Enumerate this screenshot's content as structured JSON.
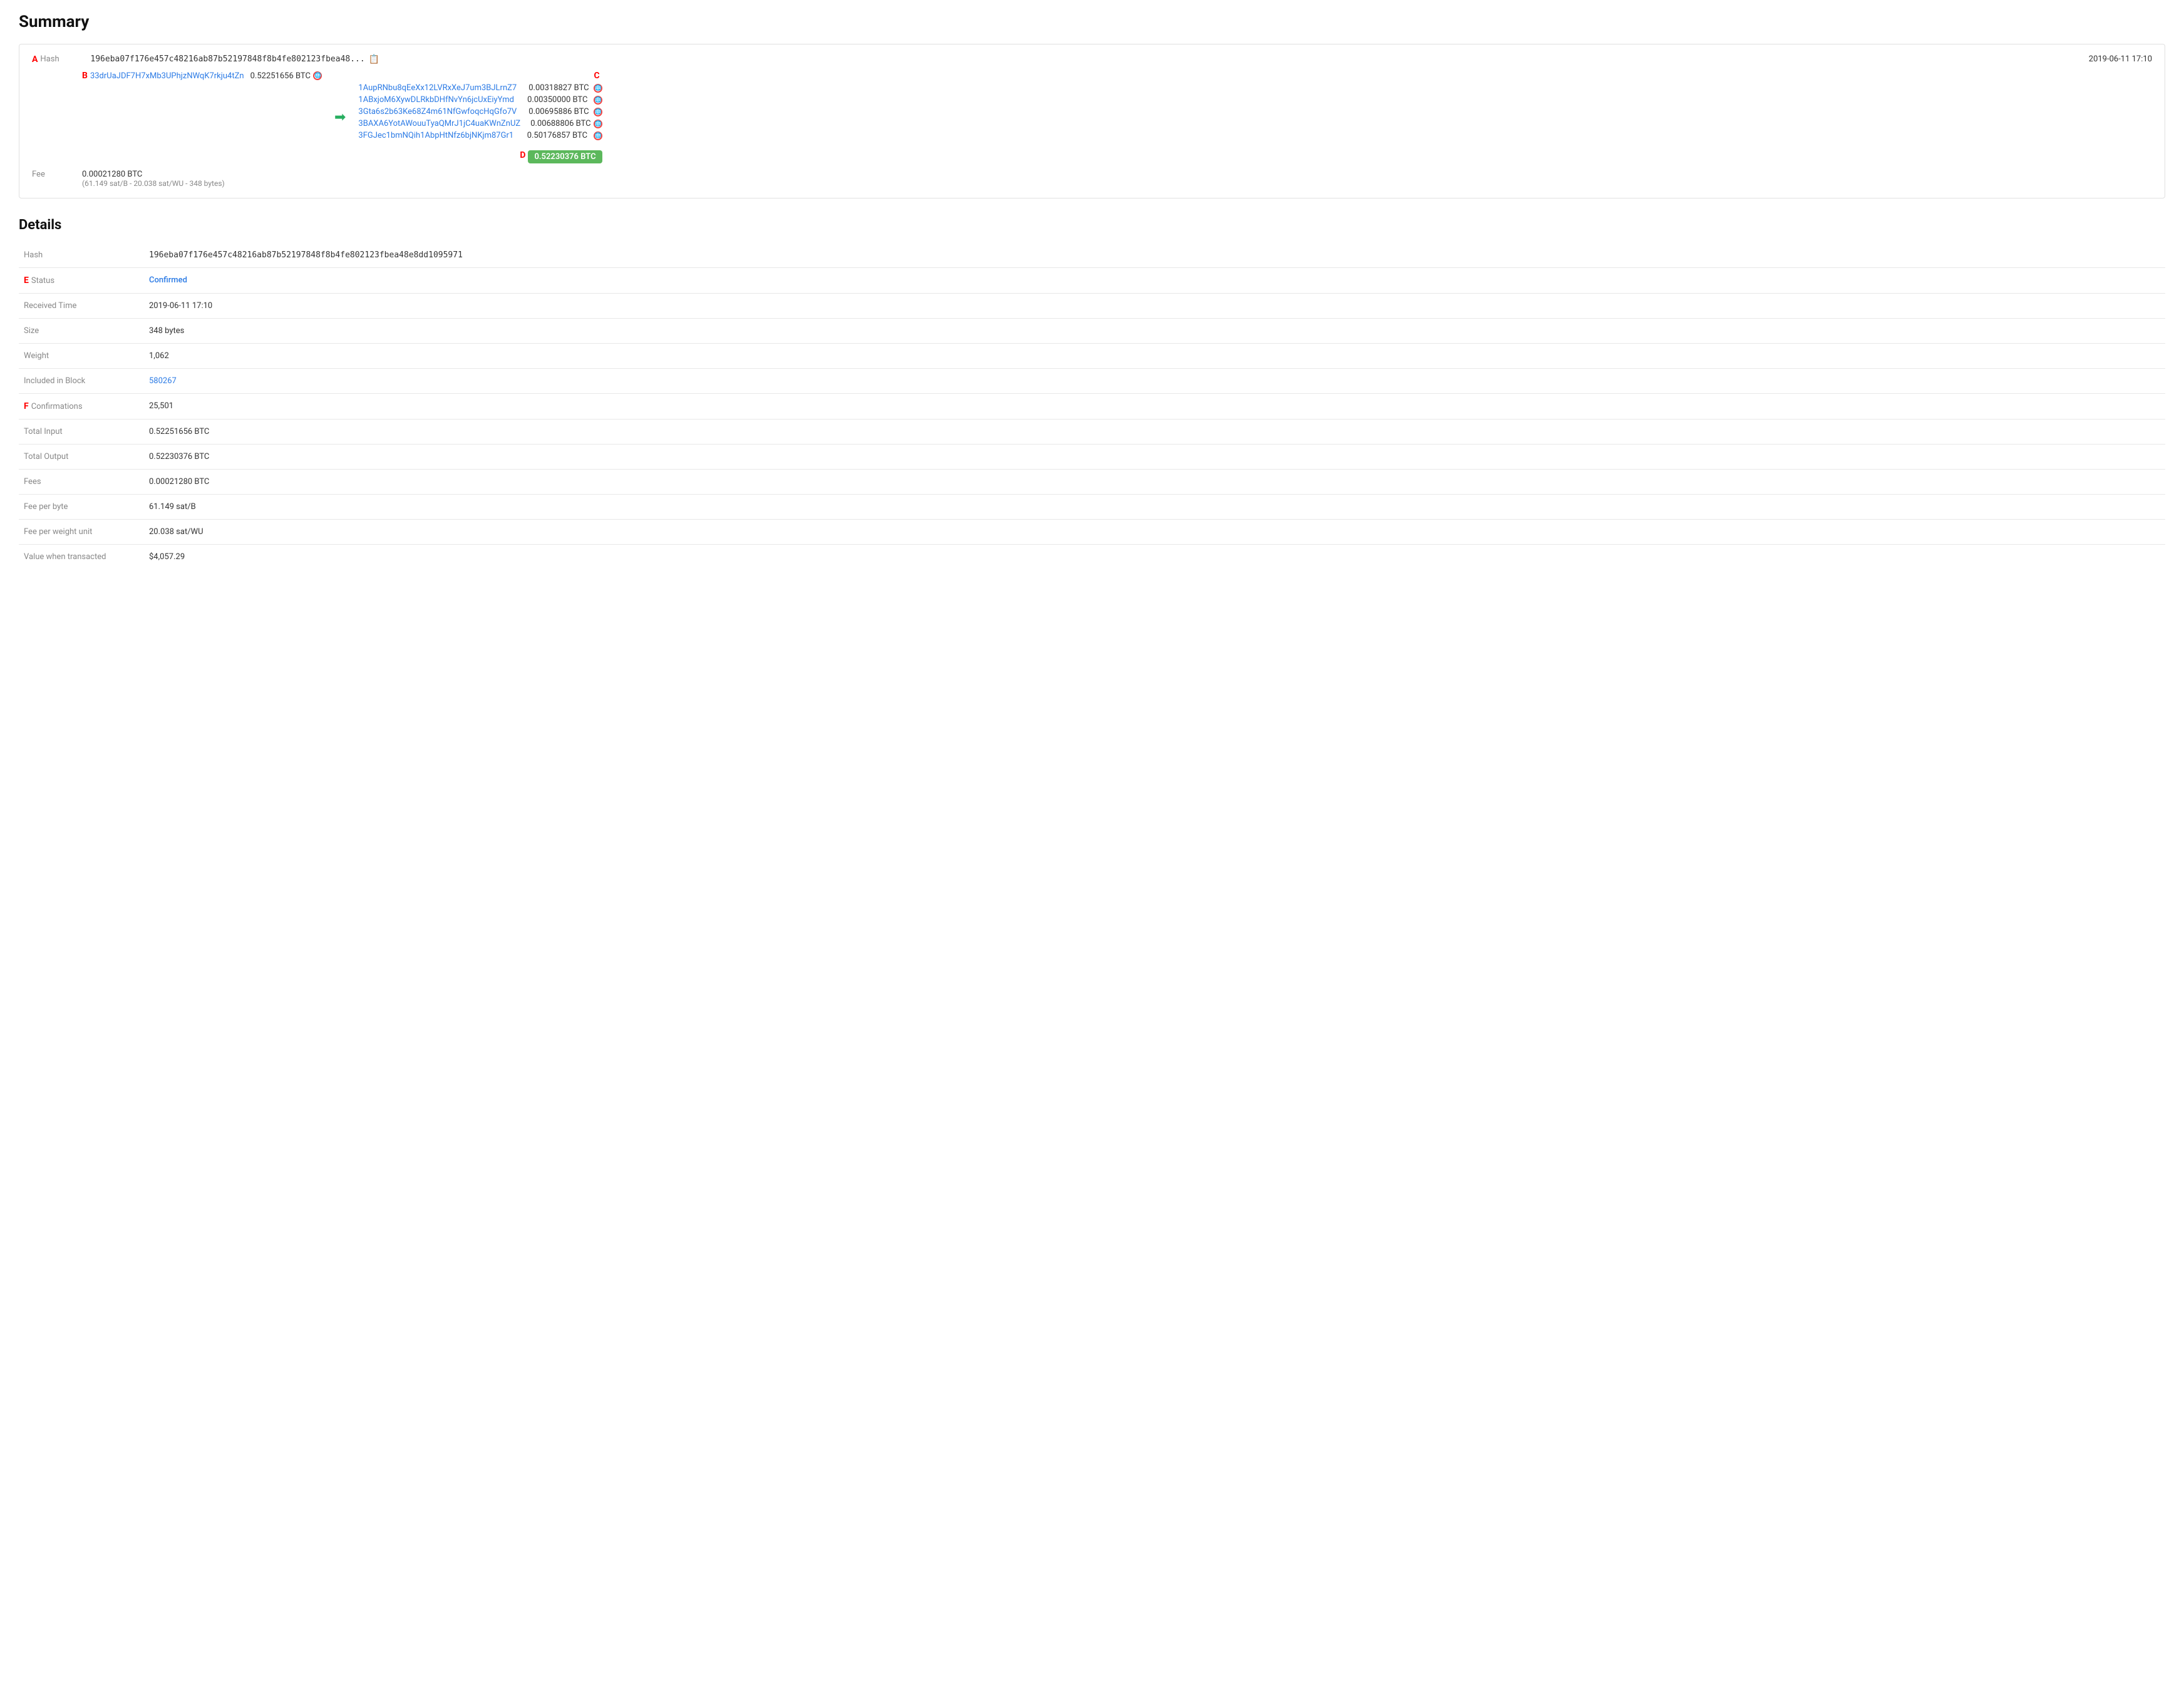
{
  "page": {
    "summary_title": "Summary",
    "details_title": "Details"
  },
  "summary": {
    "hash_label": "Hash",
    "hash_short": "196eba07f176e457c48216ab87b52197848f8b4fe802123fbea48...",
    "timestamp": "2019-06-11 17:10",
    "input_address": "33drUaJDF7H7xMb3UPhjzNWqK7rkju4tZn",
    "input_amount": "0.52251656 BTC",
    "outputs": [
      {
        "address": "1AupRNbu8qEeXx12LVRxXeJ7um3BJLrnZ7",
        "amount": "0.00318827 BTC"
      },
      {
        "address": "1ABxjoM6XywDLRkbDHfNvYn6jcUxEiyYmd",
        "amount": "0.00350000 BTC"
      },
      {
        "address": "3Gta6s2b63Ke68Z4m61NfGwfoqcHqGfo7V",
        "amount": "0.00695886 BTC"
      },
      {
        "address": "3BAXA6YotAWouuTyaQMrJ1jC4uaKWnZnUZ",
        "amount": "0.00688806 BTC"
      },
      {
        "address": "3FGJec1bmNQih1AbpHtNfz6bjNKjm87Gr1",
        "amount": "0.50176857 BTC"
      }
    ],
    "total_output": "0.52230376 BTC",
    "fee_label": "Fee",
    "fee_value": "0.00021280 BTC",
    "fee_detail": "(61.149 sat/B - 20.038 sat/WU - 348 bytes)"
  },
  "details": {
    "rows": [
      {
        "label": "Hash",
        "value": "196eba07f176e457c48216ab87b52197848f8b4fe802123fbea48e8dd1095971",
        "type": "hash"
      },
      {
        "label": "Status",
        "value": "Confirmed",
        "type": "status"
      },
      {
        "label": "Received Time",
        "value": "2019-06-11 17:10",
        "type": "text"
      },
      {
        "label": "Size",
        "value": "348 bytes",
        "type": "text"
      },
      {
        "label": "Weight",
        "value": "1,062",
        "type": "text"
      },
      {
        "label": "Included in Block",
        "value": "580267",
        "type": "link"
      },
      {
        "label": "Confirmations",
        "value": "25,501",
        "type": "text"
      },
      {
        "label": "Total Input",
        "value": "0.52251656 BTC",
        "type": "text"
      },
      {
        "label": "Total Output",
        "value": "0.52230376 BTC",
        "type": "text"
      },
      {
        "label": "Fees",
        "value": "0.00021280 BTC",
        "type": "text"
      },
      {
        "label": "Fee per byte",
        "value": "61.149 sat/B",
        "type": "text"
      },
      {
        "label": "Fee per weight unit",
        "value": "20.038 sat/WU",
        "type": "text"
      },
      {
        "label": "Value when transacted",
        "value": "$4,057.29",
        "type": "text"
      }
    ]
  },
  "annotations": {
    "a": "A",
    "b": "B",
    "c": "C",
    "d": "D",
    "e": "E",
    "f": "F"
  }
}
